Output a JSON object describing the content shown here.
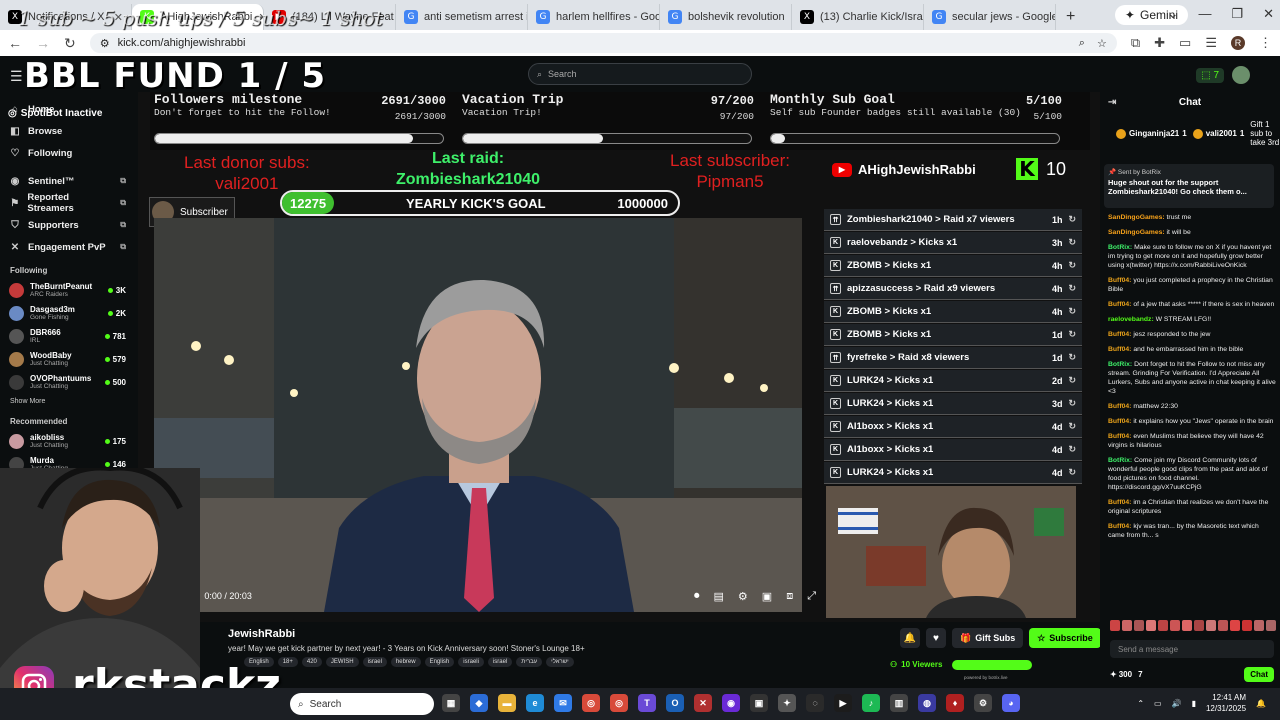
{
  "browser": {
    "tabs": [
      {
        "label": "Notifications / X",
        "fav": "X",
        "color": "#000000"
      },
      {
        "label": "AHighJewishRabbi",
        "fav": "K",
        "color": "#53fc18",
        "active": true
      },
      {
        "label": "(184) Lil Wayne Feat",
        "fav": "▶",
        "color": "#e00000"
      },
      {
        "label": "anti semetism arrest in",
        "fav": "G",
        "color": "#4285f4"
      },
      {
        "label": "harlem hellfires - Goog",
        "fav": "G",
        "color": "#4285f4"
      },
      {
        "label": "bolshevik revolution",
        "fav": "G",
        "color": "#4285f4"
      },
      {
        "label": "(13) Charlie Kick/Israel",
        "fav": "X",
        "color": "#000000"
      },
      {
        "label": "secular jews - Google S",
        "fav": "G",
        "color": "#4285f4"
      }
    ],
    "new_tab": "+",
    "gemini": "Gemini",
    "url": "kick.com/ahighjewishrabbi",
    "profile_initial": "R"
  },
  "overlay": {
    "top_text": "1 sub ~ 5 push ups / 5 subs~ 1 shot",
    "fund_title": "BBL FUND  1 / 5",
    "goals": [
      {
        "title": "Followers milestone",
        "sub": "Don't forget to hit the Follow!",
        "count": "2691/3000",
        "count2": "2691/3000",
        "progress": 0.897
      },
      {
        "title": "Vacation Trip",
        "sub": "Vacation Trip!",
        "count": "97/200",
        "count2": "97/200",
        "progress": 0.485
      },
      {
        "title": "Monthly Sub Goal",
        "sub": "Self sub Founder badges still available (30)",
        "count": "5/100",
        "count2": "5/100",
        "progress": 0.05
      }
    ],
    "last_donor_label": "Last donor subs:",
    "last_donor_name": "vali2001",
    "last_raid_label": "Last raid:",
    "last_raid_name": "Zombieshark21040",
    "last_sub_label": "Last subscriber:",
    "last_sub_name": "Pipman5",
    "youtube_name": "AHighJewishRabbi",
    "kick_count": "10",
    "subscriber_label": "Subscriber",
    "yearly_current": "12275",
    "yearly_label": "YEARLY KICK'S GOAL",
    "yearly_target": "1000000",
    "rkstackz": "rkstackz_"
  },
  "events": [
    {
      "text": "Zombieshark21040 > Raid x7 viewers",
      "time": "1h"
    },
    {
      "text": "raelovebandz > Kicks x1",
      "time": "3h"
    },
    {
      "text": "ZBOMB > Kicks x1",
      "time": "4h"
    },
    {
      "text": "apizzasuccess > Raid x9 viewers",
      "time": "4h"
    },
    {
      "text": "ZBOMB > Kicks x1",
      "time": "4h"
    },
    {
      "text": "ZBOMB > Kicks x1",
      "time": "1d"
    },
    {
      "text": "fyrefreke > Raid x8 viewers",
      "time": "1d"
    },
    {
      "text": "LURK24 > Kicks x1",
      "time": "2d"
    },
    {
      "text": "LURK24 > Kicks x1",
      "time": "3d"
    },
    {
      "text": "AI1boxx > Kicks x1",
      "time": "4d"
    },
    {
      "text": "AI1boxx > Kicks x1",
      "time": "4d"
    },
    {
      "text": "LURK24 > Kicks x1",
      "time": "4d"
    }
  ],
  "video": {
    "time": "0:00 / 20:03"
  },
  "kick": {
    "search_placeholder": "Search",
    "notif_count": "7"
  },
  "sidebar": {
    "spotibot": "SpotiBot Inactive",
    "nav": [
      {
        "label": "Home",
        "icon": "⌂"
      },
      {
        "label": "Browse",
        "icon": "◧"
      },
      {
        "label": "Following",
        "icon": "♡"
      }
    ],
    "extras": [
      {
        "label": "Sentinel™",
        "icon": "◉"
      },
      {
        "label": "Reported Streamers",
        "icon": "⚑"
      },
      {
        "label": "Supporters",
        "icon": "⛉"
      },
      {
        "label": "Engagement PvP",
        "icon": "✕"
      }
    ],
    "following_label": "Following",
    "following": [
      {
        "name": "TheBurntPeanut",
        "game": "ARC Raiders",
        "viewers": "3K",
        "color": "#c43a3a"
      },
      {
        "name": "Dasgasd3m",
        "game": "Gone Fishing",
        "viewers": "2K",
        "color": "#6a8ac4"
      },
      {
        "name": "DBR666",
        "game": "IRL",
        "viewers": "781",
        "color": "#555555"
      },
      {
        "name": "WoodBaby",
        "game": "Just Chatting",
        "viewers": "579",
        "color": "#a47a4a"
      },
      {
        "name": "OVOPhantuums",
        "game": "Just Chatting",
        "viewers": "500",
        "color": "#3a3a3a"
      }
    ],
    "show_more": "Show More",
    "recommended_label": "Recommended",
    "recommended": [
      {
        "name": "aikobliss",
        "game": "Just Chatting",
        "viewers": "175",
        "color": "#c89aa0"
      },
      {
        "name": "Murda",
        "game": "Just Chatting",
        "viewers": "146",
        "color": "#444444"
      }
    ]
  },
  "channel": {
    "name": "JewishRabbi",
    "title": "year! May we get kick partner by next year! - 3 Years on Kick Anniversary soon! Stoner's Lounge 18+",
    "tags": [
      "English",
      "18+",
      "420",
      "JEWISH",
      "israel",
      "hebrew",
      "English",
      "israeli",
      "israel",
      "עברית",
      "ישראלי"
    ],
    "gift_subs": "Gift Subs",
    "subscribe": "Subscribe",
    "viewers": "10 Viewers",
    "powered": "powered by botrix.live"
  },
  "chat": {
    "title": "Chat",
    "gifters": [
      {
        "name": "Ginganinja21",
        "count": "1"
      },
      {
        "name": "vali2001",
        "count": "1"
      }
    ],
    "gift_note": "Gift 1 sub to take 3rd",
    "pinned_head": "Sent by BotRix",
    "pinned_body": "Huge shout out for the support Zombieshark21040! Go check them o...",
    "messages": [
      {
        "user": "SanDingoGames:",
        "text": "trust me",
        "cls": "o"
      },
      {
        "user": "SanDingoGames:",
        "text": "it will be",
        "cls": "o"
      },
      {
        "user": "BotRix:",
        "text": "Make sure to follow me on X if you havent yet im trying to get more on it and hopefully grow better using x(twitter) https://x.com/RabbiLiveOnKick",
        "cls": "b"
      },
      {
        "user": "Buff04:",
        "text": "you just completed a prophecy in the Christian Bible",
        "cls": ""
      },
      {
        "user": "Buff04:",
        "text": "of a jew that asks ***** if there is sex in heaven",
        "cls": ""
      },
      {
        "user": "raelovebandz:",
        "text": "W STREAM LFG!!",
        "cls": "g"
      },
      {
        "user": "Buff04:",
        "text": "jesz responded to the jew",
        "cls": ""
      },
      {
        "user": "Buff04:",
        "text": "and he embarrassed him in the bible",
        "cls": ""
      },
      {
        "user": "BotRix:",
        "text": "Dont forget to hit the Follow to not miss any stream. Grinding For Verification. I'd Appreciate All Lurkers, Subs and anyone active in chat keeping it alive <3",
        "cls": "b"
      },
      {
        "user": "Buff04:",
        "text": "matthew 22:30",
        "cls": ""
      },
      {
        "user": "Buff04:",
        "text": "it explains how you \"Jews\" operate in the brain",
        "cls": ""
      },
      {
        "user": "Buff04:",
        "text": "even Muslims that believe they will have 42 virgins is hilarious",
        "cls": ""
      },
      {
        "user": "BotRix:",
        "text": "Come join my Discord Community lots of wonderful people good clips from the past and alot of food pictures on food channel. https://discord.gg/vX7uuKCPjG",
        "cls": "b"
      },
      {
        "user": "Buff04:",
        "text": "im a Christian that realizes we don't have the original scriptures",
        "cls": ""
      },
      {
        "user": "Buff04:",
        "text": "kjv was tran... by the Masoretic text which came from th... s",
        "cls": ""
      }
    ],
    "send_placeholder": "Send a message",
    "points": "300",
    "count": "7",
    "chat_button": "Chat"
  },
  "taskbar": {
    "search": "Search",
    "time": "12:41 AM",
    "date": "12/31/2025"
  },
  "colors": {
    "kick_green": "#53fc18",
    "red": "#e02020"
  }
}
